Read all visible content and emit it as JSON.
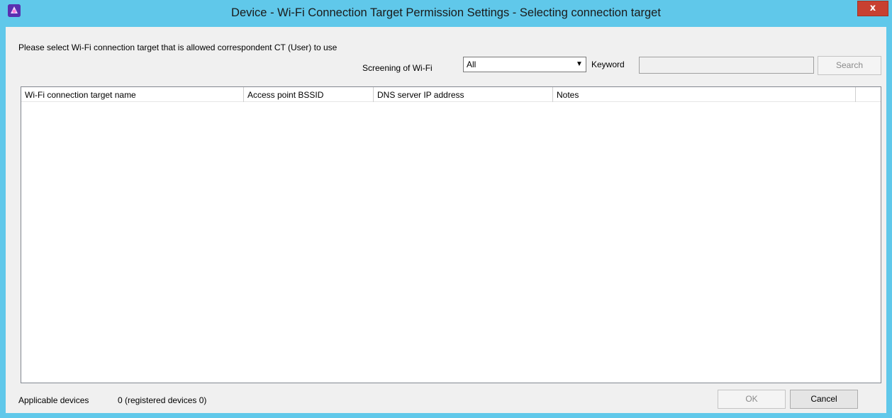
{
  "window": {
    "title": "Device - Wi-Fi Connection Target Permission Settings - Selecting connection target",
    "close_label": "x",
    "app_icon": "app-icon"
  },
  "form": {
    "instruction": "Please select Wi-Fi connection target that is allowed correspondent CT (User) to use",
    "screening_label": "Screening of Wi-Fi",
    "screening_value": "All",
    "keyword_label": "Keyword",
    "keyword_value": "",
    "search_label": "Search"
  },
  "list": {
    "columns": [
      "Wi-Fi connection target name",
      "Access point BSSID",
      "DNS server IP address",
      "Notes",
      ""
    ],
    "rows": []
  },
  "status": {
    "label": "Applicable devices",
    "value": "0 (registered devices    0)"
  },
  "buttons": {
    "ok": "OK",
    "cancel": "Cancel"
  },
  "colors": {
    "titlebar": "#60c8ea",
    "close": "#c84031",
    "client": "#f0f0f0"
  }
}
